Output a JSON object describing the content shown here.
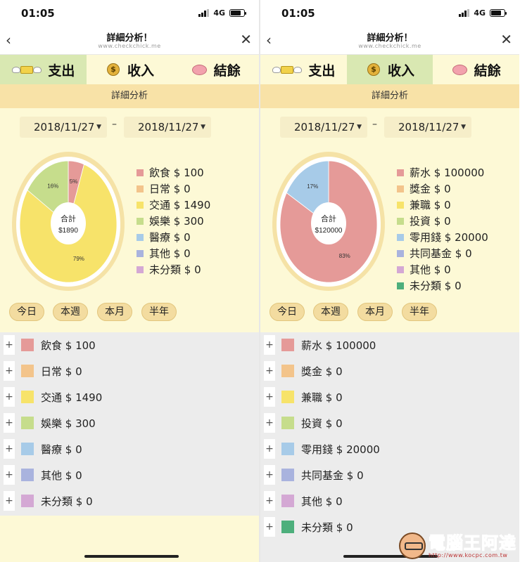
{
  "status_bar": {
    "time": "01:05",
    "network": "4G"
  },
  "nav": {
    "title": "詳細分析！",
    "url": "www.checkchick.me",
    "back_icon": "chevron-left-icon",
    "close_icon": "close-icon"
  },
  "tabs": [
    {
      "label": "支出",
      "icon": "flying-money-icon"
    },
    {
      "label": "收入",
      "icon": "money-bag-icon"
    },
    {
      "label": "結餘",
      "icon": "piggy-bank-icon"
    }
  ],
  "section_title": "詳細分析",
  "date_range": {
    "start": "2018/11/27",
    "separator": "–",
    "end": "2018/11/27"
  },
  "periods": [
    "今日",
    "本週",
    "本月",
    "半年"
  ],
  "chart_total_label": "合計",
  "watermark": {
    "title": "電腦王阿達",
    "url": "http://www.kocpc.com.tw"
  },
  "left_screen": {
    "active_tab": 0,
    "total": "$1890",
    "legend": [
      {
        "text": "飲食 $ 100",
        "color": "#e59a98"
      },
      {
        "text": "日常 $ 0",
        "color": "#f3c48b"
      },
      {
        "text": "交通 $ 1490",
        "color": "#f7e36a"
      },
      {
        "text": "娛樂 $ 300",
        "color": "#c6dd8c"
      },
      {
        "text": "醫療 $ 0",
        "color": "#a7cbe8"
      },
      {
        "text": "其他 $ 0",
        "color": "#a9b3de"
      },
      {
        "text": "未分類 $ 0",
        "color": "#d4a8d4"
      }
    ],
    "list": [
      {
        "text": "飲食 $ 100",
        "color": "#e59a98"
      },
      {
        "text": "日常 $ 0",
        "color": "#f3c48b"
      },
      {
        "text": "交通 $ 1490",
        "color": "#f7e36a"
      },
      {
        "text": "娛樂 $ 300",
        "color": "#c6dd8c"
      },
      {
        "text": "醫療 $ 0",
        "color": "#a7cbe8"
      },
      {
        "text": "其他 $ 0",
        "color": "#a9b3de"
      },
      {
        "text": "未分類 $ 0",
        "color": "#d4a8d4"
      }
    ]
  },
  "right_screen": {
    "active_tab": 1,
    "total": "$120000",
    "legend": [
      {
        "text": "薪水 $ 100000",
        "color": "#e59a98"
      },
      {
        "text": "獎金 $ 0",
        "color": "#f3c48b"
      },
      {
        "text": "兼職 $ 0",
        "color": "#f7e36a"
      },
      {
        "text": "投資 $ 0",
        "color": "#c6dd8c"
      },
      {
        "text": "零用錢 $ 20000",
        "color": "#a7cbe8"
      },
      {
        "text": "共同基金 $ 0",
        "color": "#a9b3de"
      },
      {
        "text": "其他 $ 0",
        "color": "#d4a8d4"
      },
      {
        "text": "未分類 $ 0",
        "color": "#4daf7c"
      }
    ],
    "list": [
      {
        "text": "薪水 $ 100000",
        "color": "#e59a98"
      },
      {
        "text": "獎金 $ 0",
        "color": "#f3c48b"
      },
      {
        "text": "兼職 $ 0",
        "color": "#f7e36a"
      },
      {
        "text": "投資 $ 0",
        "color": "#c6dd8c"
      },
      {
        "text": "零用錢 $ 20000",
        "color": "#a7cbe8"
      },
      {
        "text": "共同基金 $ 0",
        "color": "#a9b3de"
      },
      {
        "text": "其他 $ 0",
        "color": "#d4a8d4"
      },
      {
        "text": "未分類 $ 0",
        "color": "#4daf7c"
      }
    ]
  },
  "chart_data": [
    {
      "type": "pie",
      "categories": [
        "飲食",
        "交通",
        "娛樂"
      ],
      "values": [
        100,
        1490,
        300
      ],
      "labels": [
        "5%",
        "79%",
        "16%"
      ],
      "colors": [
        "#e59a98",
        "#f7e36a",
        "#c6dd8c"
      ]
    },
    {
      "type": "pie",
      "categories": [
        "薪水",
        "零用錢"
      ],
      "values": [
        100000,
        20000
      ],
      "labels": [
        "83%",
        "17%"
      ],
      "colors": [
        "#e59a98",
        "#a7cbe8"
      ]
    }
  ]
}
